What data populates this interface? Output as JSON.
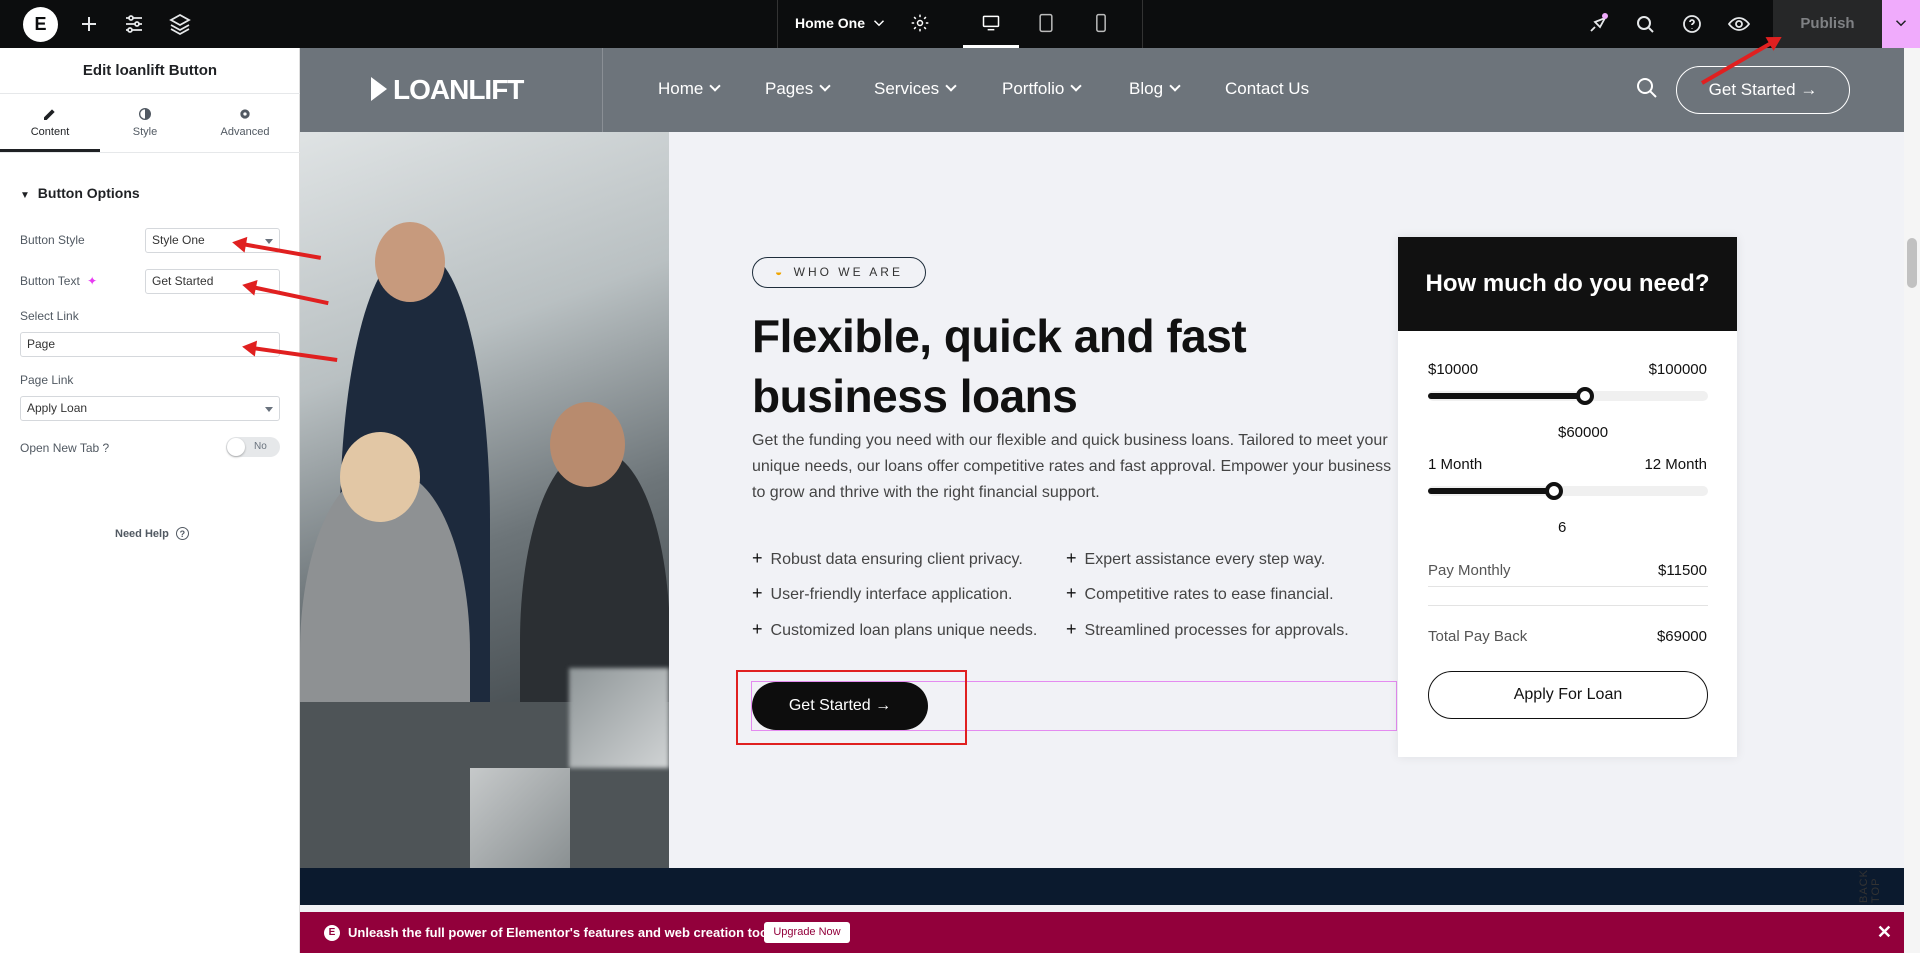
{
  "topbar": {
    "page_name": "Home One",
    "publish_label": "Publish"
  },
  "panel": {
    "title": "Edit loanlift Button",
    "tabs": [
      {
        "label": "Content"
      },
      {
        "label": "Style"
      },
      {
        "label": "Advanced"
      }
    ],
    "section_title": "Button Options",
    "fields": {
      "button_style_label": "Button Style",
      "button_style_value": "Style One",
      "button_text_label": "Button Text",
      "button_text_value": "Get Started",
      "select_link_label": "Select Link",
      "select_link_value": "Page",
      "page_link_label": "Page Link",
      "page_link_value": "Apply Loan",
      "open_new_tab_label": "Open New Tab ?",
      "open_new_tab_value": "No"
    },
    "need_help": "Need Help"
  },
  "site": {
    "brand": "LOANLIFT",
    "nav": [
      "Home",
      "Pages",
      "Services",
      "Portfolio",
      "Blog",
      "Contact Us"
    ],
    "header_button": "Get Started",
    "tag": "WHO WE ARE",
    "hero_title_line1": "Flexible, quick and fast",
    "hero_title_line2": "business loans",
    "hero_desc": "Get the funding you need with our flexible and quick business loans. Tailored to meet your unique needs, our loans offer competitive rates and fast approval. Empower your business to grow and thrive with the right financial support.",
    "features_left": [
      "Robust data ensuring client privacy.",
      "User-friendly interface application.",
      "Customized loan plans unique needs."
    ],
    "features_right": [
      "Expert assistance every step way.",
      "Competitive rates to ease financial.",
      "Streamlined processes for approvals."
    ],
    "hero_button": "Get Started",
    "back_top": "BACK TOP"
  },
  "calculator": {
    "title": "How much do you need?",
    "amount_min": "$10000",
    "amount_max": "$100000",
    "amount_value": "$60000",
    "amount_fraction": 0.56,
    "term_min": "1 Month",
    "term_max": "12 Month",
    "term_value": "6",
    "term_fraction": 0.45,
    "pay_monthly_label": "Pay Monthly",
    "pay_monthly_value": "$11500",
    "total_label": "Total Pay Back",
    "total_value": "$69000",
    "apply_button": "Apply For Loan"
  },
  "upgrade_bar": {
    "message": "Unleash the full power of Elementor's features and web creation tools.",
    "button": "Upgrade Now"
  },
  "colors": {
    "accent_pink": "#f0abfc",
    "upgrade_bg": "#92003b",
    "annotation_red": "#e02020"
  }
}
